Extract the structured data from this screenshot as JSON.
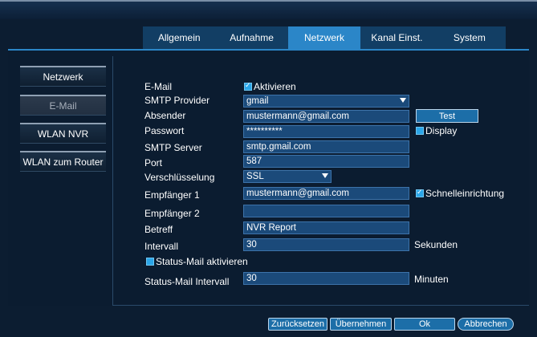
{
  "tabs": [
    "Allgemein",
    "Aufnahme",
    "Netzwerk",
    "Kanal Einst.",
    "System"
  ],
  "active_tab": "Netzwerk",
  "sidebar": [
    "Netzwerk",
    "E-Mail",
    "WLAN NVR",
    "WLAN zum Router"
  ],
  "active_sidebar": "E-Mail",
  "form": {
    "email_label": "E-Mail",
    "activate_label": "Aktivieren",
    "activate_checked": true,
    "smtp_provider_label": "SMTP Provider",
    "smtp_provider_value": "gmail",
    "sender_label": "Absender",
    "sender_value": "mustermann@gmail.com",
    "test_label": "Test",
    "password_label": "Passwort",
    "password_value": "**********",
    "display_label": "Display",
    "display_checked": false,
    "smtp_server_label": "SMTP Server",
    "smtp_server_value": "smtp.gmail.com",
    "port_label": "Port",
    "port_value": "587",
    "encryption_label": "Verschlüsselung",
    "encryption_value": "SSL",
    "recipient1_label": "Empfänger 1",
    "recipient1_value": "mustermann@gmail.com",
    "quick_setup_label": "Schnelleinrichtung",
    "quick_setup_checked": true,
    "recipient2_label": "Empfänger 2",
    "recipient2_value": "",
    "subject_label": "Betreff",
    "subject_value": "NVR Report",
    "interval_label": "Intervall",
    "interval_value": "30",
    "interval_unit": "Sekunden",
    "status_mail_label": "Status-Mail aktivieren",
    "status_mail_checked": false,
    "status_interval_label": "Status-Mail Intervall",
    "status_interval_value": "30",
    "status_interval_unit": "Minuten"
  },
  "footer": {
    "reset": "Zurücksetzen",
    "apply": "Übernehmen",
    "ok": "Ok",
    "cancel": "Abbrechen"
  },
  "colors": {
    "accent": "#2b86c8",
    "tab_bg": "#123e64",
    "field_bg": "#1b4a7a",
    "button_bg": "#1c6ea8",
    "checkbox": "#2ba6e8"
  }
}
